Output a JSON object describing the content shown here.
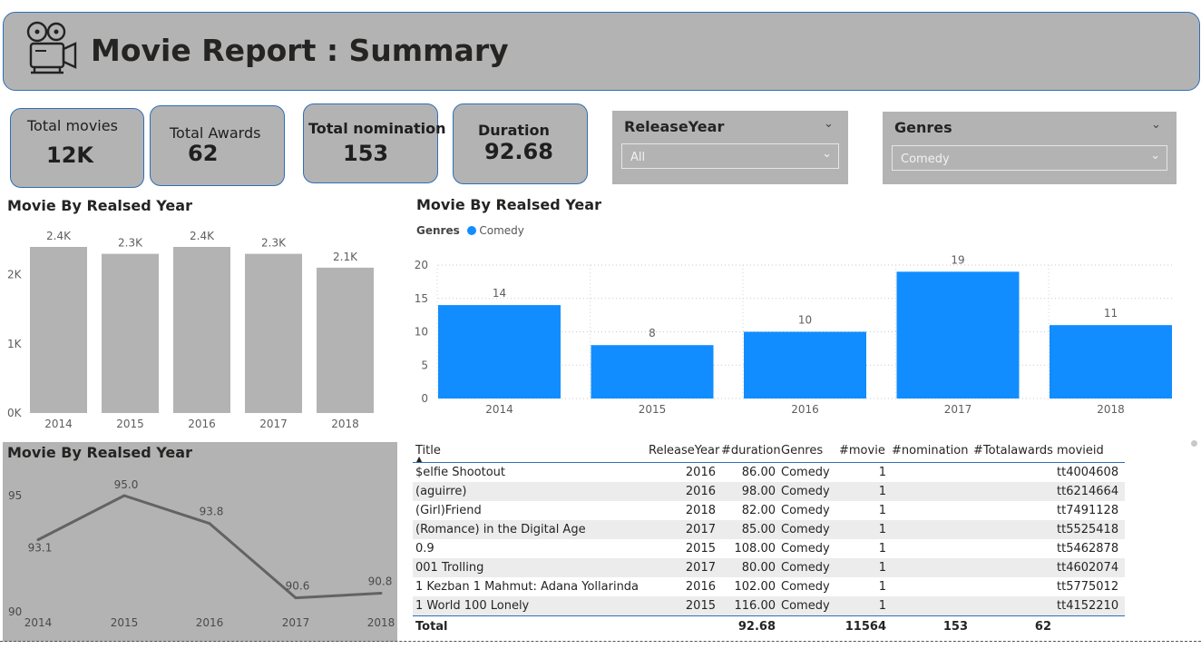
{
  "header": {
    "title": "Movie Report : Summary",
    "icon": "movie-projector-icon"
  },
  "kpis": [
    {
      "label": "Total movies",
      "value": "12K"
    },
    {
      "label": "Total Awards",
      "value": "62"
    },
    {
      "label": "Total nomination",
      "value": "153"
    },
    {
      "label": "Duration",
      "value": "92.68"
    }
  ],
  "slicers": {
    "release_year": {
      "title": "ReleaseYear",
      "value": "All"
    },
    "genres": {
      "title": "Genres",
      "value": "Comedy"
    }
  },
  "chart_data": [
    {
      "type": "bar",
      "title": "Movie By Realsed Year",
      "categories": [
        "2014",
        "2015",
        "2016",
        "2017",
        "2018"
      ],
      "values": [
        2400,
        2300,
        2400,
        2300,
        2100
      ],
      "value_labels": [
        "2.4K",
        "2.3K",
        "2.4K",
        "2.3K",
        "2.1K"
      ],
      "yticks": [
        "0K",
        "1K",
        "2K"
      ],
      "ylim": [
        0,
        2400
      ],
      "color": "#b3b3b3",
      "grid": false
    },
    {
      "type": "bar",
      "title": "Movie By Realsed Year",
      "legend_title": "Genres",
      "categories": [
        "2014",
        "2015",
        "2016",
        "2017",
        "2018"
      ],
      "series": [
        {
          "name": "Comedy",
          "values": [
            14,
            8,
            10,
            19,
            11
          ],
          "color": "#118dff"
        }
      ],
      "yticks": [
        "0",
        "5",
        "10",
        "15",
        "20"
      ],
      "ylim": [
        0,
        20
      ],
      "grid": true,
      "legend_position": "top-left"
    },
    {
      "type": "line",
      "title": "Movie By Realsed Year",
      "categories": [
        "2014",
        "2015",
        "2016",
        "2017",
        "2018"
      ],
      "values": [
        93.1,
        95.0,
        93.8,
        90.6,
        90.8
      ],
      "value_labels": [
        "93.1",
        "95.0",
        "93.8",
        "90.6",
        "90.8"
      ],
      "yticks": [
        "90",
        "95"
      ],
      "ylim": [
        90,
        95
      ],
      "color": "#636363",
      "background": "#b3b3b3"
    }
  ],
  "table": {
    "columns": [
      "Title",
      "ReleaseYear",
      "#duration",
      "Genres",
      "#movie",
      "#nomination",
      "#Totalawards",
      "movieid"
    ],
    "sort_indicator": "▲",
    "rows": [
      [
        "$elfie Shootout",
        "2016",
        "86.00",
        "Comedy",
        "1",
        "",
        "",
        "tt4004608"
      ],
      [
        "(aguirre)",
        "2016",
        "98.00",
        "Comedy",
        "1",
        "",
        "",
        "tt6214664"
      ],
      [
        "(Girl)Friend",
        "2018",
        "82.00",
        "Comedy",
        "1",
        "",
        "",
        "tt7491128"
      ],
      [
        "(Romance) in the Digital Age",
        "2017",
        "85.00",
        "Comedy",
        "1",
        "",
        "",
        "tt5525418"
      ],
      [
        "0.9",
        "2015",
        "108.00",
        "Comedy",
        "1",
        "",
        "",
        "tt5462878"
      ],
      [
        "001 Trolling",
        "2017",
        "80.00",
        "Comedy",
        "1",
        "",
        "",
        "tt4602074"
      ],
      [
        "1 Kezban 1 Mahmut: Adana Yollarinda",
        "2016",
        "102.00",
        "Comedy",
        "1",
        "",
        "",
        "tt5775012"
      ],
      [
        "1 World 100 Lonely",
        "2015",
        "116.00",
        "Comedy",
        "1",
        "",
        "",
        "tt4152210"
      ]
    ],
    "total": [
      "Total",
      "",
      "92.68",
      "",
      "11564",
      "153",
      "62",
      ""
    ]
  }
}
